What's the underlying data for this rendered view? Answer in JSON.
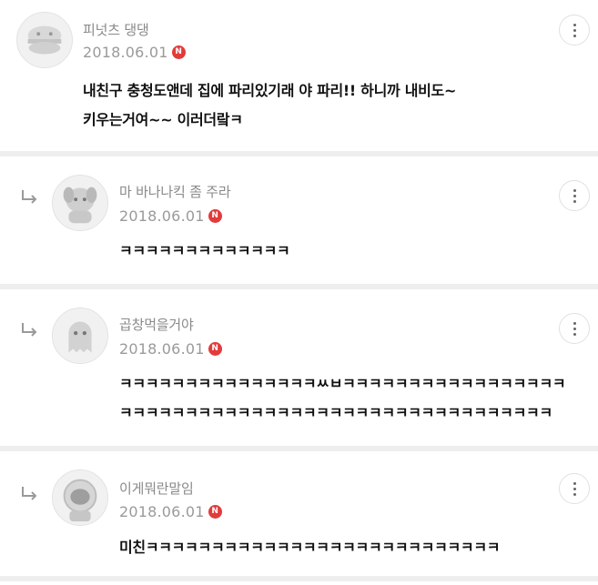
{
  "comments": [
    {
      "nickname": "피넛츠 댕댕",
      "date": "2018.06.01",
      "badge": "N",
      "lines": [
        "내친구 충청도앤데 집에 파리있기래 야 파리!! 하니까 내비도~",
        "키우는거여~~ 이러더랔ㅋ"
      ],
      "is_reply": false,
      "avatar_icon": "burger-character-icon"
    },
    {
      "nickname": "마 바나나킥 좀 주라",
      "date": "2018.06.01",
      "badge": "N",
      "lines": [
        "ㅋㅋㅋㅋㅋㅋㅋㅋㅋㅋㅋㅋㅋ"
      ],
      "is_reply": true,
      "avatar_icon": "dog-character-icon"
    },
    {
      "nickname": "곱창먹을거야",
      "date": "2018.06.01",
      "badge": "N",
      "lines": [
        "ㅋㅋㅋㅋㅋㅋㅋㅋㅋㅋㅋㅋㅋㅋㅋㅆㅂㅋㅋㅋㅋㅋㅋㅋㅋㅋㅋㅋㅋㅋㅋㅋㅋㅋ",
        "ㅋㅋㅋㅋㅋㅋㅋㅋㅋㅋㅋㅋㅋㅋㅋㅋㅋㅋㅋㅋㅋㅋㅋㅋㅋㅋㅋㅋㅋㅋㅋㅋㅋ"
      ],
      "is_reply": true,
      "avatar_icon": "ghost-character-icon"
    },
    {
      "nickname": "이게뭐란말임",
      "date": "2018.06.01",
      "badge": "N",
      "lines": [
        "미친ㅋㅋㅋㅋㅋㅋㅋㅋㅋㅋㅋㅋㅋㅋㅋㅋㅋㅋㅋㅋㅋㅋㅋㅋㅋㅋㅋ"
      ],
      "is_reply": true,
      "avatar_icon": "astronaut-character-icon"
    }
  ],
  "colors": {
    "badge": "#e23b3b",
    "separator": "#eeeeee",
    "meta": "#9a9a9a"
  }
}
